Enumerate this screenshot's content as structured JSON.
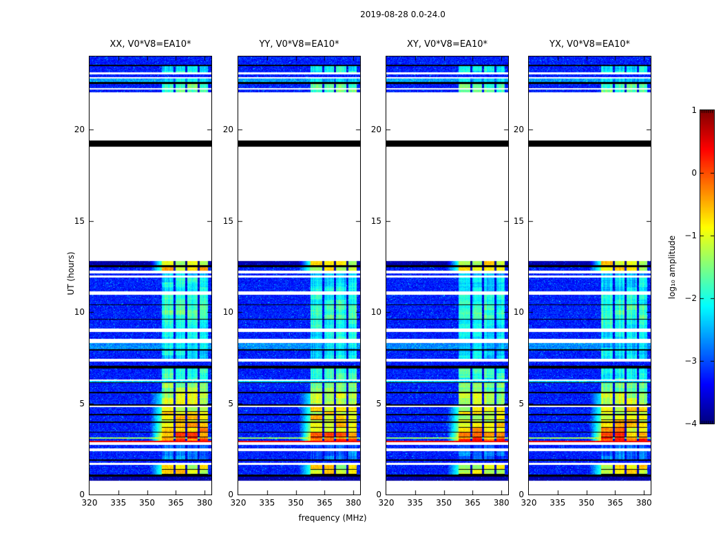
{
  "figure": {
    "title": "2019-08-28 0.0-24.0",
    "background": "#ffffff"
  },
  "chart_data": {
    "type": "heatmap",
    "title": "2019-08-28 0.0-24.0",
    "xlabel": "frequency (MHz)",
    "ylabel": "UT (hours)",
    "xlim": [
      320,
      383.5
    ],
    "ylim": [
      0,
      24
    ],
    "x_ticks": [
      320,
      335,
      350,
      365,
      380
    ],
    "x_tick_labels": [
      "320",
      "335",
      "350",
      "365",
      "380"
    ],
    "y_ticks": [
      0,
      5,
      10,
      15,
      20
    ],
    "y_tick_labels": [
      "0",
      "5",
      "10",
      "15",
      "20"
    ],
    "panels": [
      {
        "title": "XX, V0*V8=EA10*",
        "bright_offset": 0.0,
        "seed": 11
      },
      {
        "title": "YY, V0*V8=EA10*",
        "bright_offset": -0.03,
        "seed": 22
      },
      {
        "title": "XY, V0*V8=EA10*",
        "bright_offset": -0.1,
        "seed": 33
      },
      {
        "title": "YX, V0*V8=EA10*",
        "bright_offset": -0.05,
        "seed": 44
      }
    ],
    "colorbar": {
      "label": "log₁₀ amplitude",
      "colormap": "jet",
      "range": [
        -4,
        1
      ],
      "ticks": [
        1,
        0,
        -1,
        -2,
        -3,
        -4
      ],
      "tick_labels": [
        "1",
        "0",
        "−1",
        "−2",
        "−3",
        "−4"
      ]
    },
    "noise_floor": -3.25,
    "rfi_freq": {
      "lead_in_lo": 351.5,
      "bright_lo": 357.5,
      "bright_hi": 381.8,
      "gaps": [
        [
          363.7,
          364.7
        ],
        [
          370.0,
          371.0
        ],
        [
          376.3,
          377.3
        ]
      ]
    },
    "bands": [
      {
        "t0": 24.0,
        "t1": 23.56,
        "type": "noise"
      },
      {
        "t0": 23.56,
        "t1": 23.47,
        "type": "black"
      },
      {
        "t0": 23.47,
        "t1": 23.12,
        "type": "noise",
        "bright": -2.0
      },
      {
        "t0": 23.12,
        "t1": 23.02,
        "type": "white"
      },
      {
        "t0": 23.02,
        "t1": 22.88,
        "type": "noise"
      },
      {
        "t0": 22.88,
        "t1": 22.78,
        "type": "white"
      },
      {
        "t0": 22.78,
        "t1": 22.62,
        "type": "noise",
        "amp": -2.6,
        "bright": -2.2
      },
      {
        "t0": 22.62,
        "t1": 22.5,
        "type": "black"
      },
      {
        "t0": 22.5,
        "t1": 22.28,
        "type": "noise",
        "bright": -1.55
      },
      {
        "t0": 22.28,
        "t1": 22.2,
        "type": "white"
      },
      {
        "t0": 22.2,
        "t1": 22.05,
        "type": "noise",
        "bright": -1.5
      },
      {
        "t0": 22.05,
        "t1": 19.38,
        "type": "white"
      },
      {
        "t0": 19.38,
        "t1": 19.06,
        "type": "black"
      },
      {
        "t0": 19.06,
        "t1": 12.78,
        "type": "white"
      },
      {
        "t0": 12.78,
        "t1": 12.55,
        "type": "navy",
        "bright": -0.7
      },
      {
        "t0": 12.55,
        "t1": 12.47,
        "type": "black"
      },
      {
        "t0": 12.47,
        "t1": 12.25,
        "type": "noise",
        "bright": -0.6
      },
      {
        "t0": 12.25,
        "t1": 12.13,
        "type": "white"
      },
      {
        "t0": 12.13,
        "t1": 11.99,
        "type": "noise",
        "bright": -2.3
      },
      {
        "t0": 11.99,
        "t1": 11.88,
        "type": "white"
      },
      {
        "t0": 11.88,
        "t1": 11.15,
        "type": "noise",
        "bright": -2.05
      },
      {
        "t0": 11.15,
        "t1": 10.95,
        "type": "white"
      },
      {
        "t0": 10.95,
        "t1": 10.42,
        "type": "noise",
        "bright": -1.9
      },
      {
        "t0": 10.42,
        "t1": 10.38,
        "type": "black"
      },
      {
        "t0": 10.38,
        "t1": 9.62,
        "type": "noise",
        "bright": -1.7
      },
      {
        "t0": 9.62,
        "t1": 9.58,
        "type": "black"
      },
      {
        "t0": 9.58,
        "t1": 9.08,
        "type": "noise",
        "bright": -1.9
      },
      {
        "t0": 9.08,
        "t1": 8.92,
        "type": "white"
      },
      {
        "t0": 8.92,
        "t1": 8.52,
        "type": "noise",
        "bright": -2.0
      },
      {
        "t0": 8.52,
        "t1": 8.32,
        "type": "white"
      },
      {
        "t0": 8.32,
        "t1": 7.98,
        "type": "noise",
        "amp": -2.7,
        "bright": -2.2
      },
      {
        "t0": 7.98,
        "t1": 7.88,
        "type": "black"
      },
      {
        "t0": 7.88,
        "t1": 7.42,
        "type": "noise",
        "bright": -2.1
      },
      {
        "t0": 7.42,
        "t1": 7.3,
        "type": "white"
      },
      {
        "t0": 7.3,
        "t1": 7.04,
        "type": "noise"
      },
      {
        "t0": 7.04,
        "t1": 6.92,
        "type": "black"
      },
      {
        "t0": 6.92,
        "t1": 6.3,
        "type": "noise",
        "bright": -1.8
      },
      {
        "t0": 6.3,
        "t1": 6.22,
        "type": "white"
      },
      {
        "t0": 6.22,
        "t1": 6.16,
        "type": "noise",
        "amp": -2.4
      },
      {
        "t0": 6.16,
        "t1": 6.1,
        "type": "black"
      },
      {
        "t0": 6.1,
        "t1": 5.62,
        "type": "noise",
        "bright": -1.3
      },
      {
        "t0": 5.62,
        "t1": 5.56,
        "type": "black"
      },
      {
        "t0": 5.56,
        "t1": 4.94,
        "type": "noise",
        "bright": -1.05
      },
      {
        "t0": 4.94,
        "t1": 4.88,
        "type": "black"
      },
      {
        "t0": 4.88,
        "t1": 4.8,
        "type": "white"
      },
      {
        "t0": 4.8,
        "t1": 4.4,
        "type": "noise",
        "bright": -0.75
      },
      {
        "t0": 4.4,
        "t1": 4.34,
        "type": "black"
      },
      {
        "t0": 4.34,
        "t1": 4.0,
        "type": "noise",
        "bright": -0.6
      },
      {
        "t0": 4.0,
        "t1": 3.92,
        "type": "black"
      },
      {
        "t0": 3.92,
        "t1": 3.44,
        "type": "noise",
        "bright": -0.35
      },
      {
        "t0": 3.44,
        "t1": 3.38,
        "type": "black"
      },
      {
        "t0": 3.38,
        "t1": 3.14,
        "type": "noise",
        "bright": 0.1
      },
      {
        "t0": 3.14,
        "t1": 3.04,
        "type": "noise",
        "amp": -1.4,
        "bright": 0.15
      },
      {
        "t0": 3.04,
        "t1": 2.96,
        "type": "noise",
        "bright": 0.2
      },
      {
        "t0": 2.96,
        "t1": 2.86,
        "type": "redline"
      },
      {
        "t0": 2.86,
        "t1": 2.72,
        "type": "white"
      },
      {
        "t0": 2.72,
        "t1": 2.52,
        "type": "noise",
        "bright": -2.9
      },
      {
        "t0": 2.52,
        "t1": 2.38,
        "type": "white"
      },
      {
        "t0": 2.38,
        "t1": 1.92,
        "type": "noise",
        "bright": -2.7
      },
      {
        "t0": 1.92,
        "t1": 1.84,
        "type": "black"
      },
      {
        "t0": 1.84,
        "t1": 1.72,
        "type": "noise"
      },
      {
        "t0": 1.72,
        "t1": 1.62,
        "type": "white"
      },
      {
        "t0": 1.62,
        "t1": 1.08,
        "type": "noise",
        "bright": -0.75
      },
      {
        "t0": 1.08,
        "t1": 0.98,
        "type": "black"
      },
      {
        "t0": 0.98,
        "t1": 0.74,
        "type": "navy"
      },
      {
        "t0": 0.74,
        "t1": 0.0,
        "type": "white"
      }
    ]
  }
}
